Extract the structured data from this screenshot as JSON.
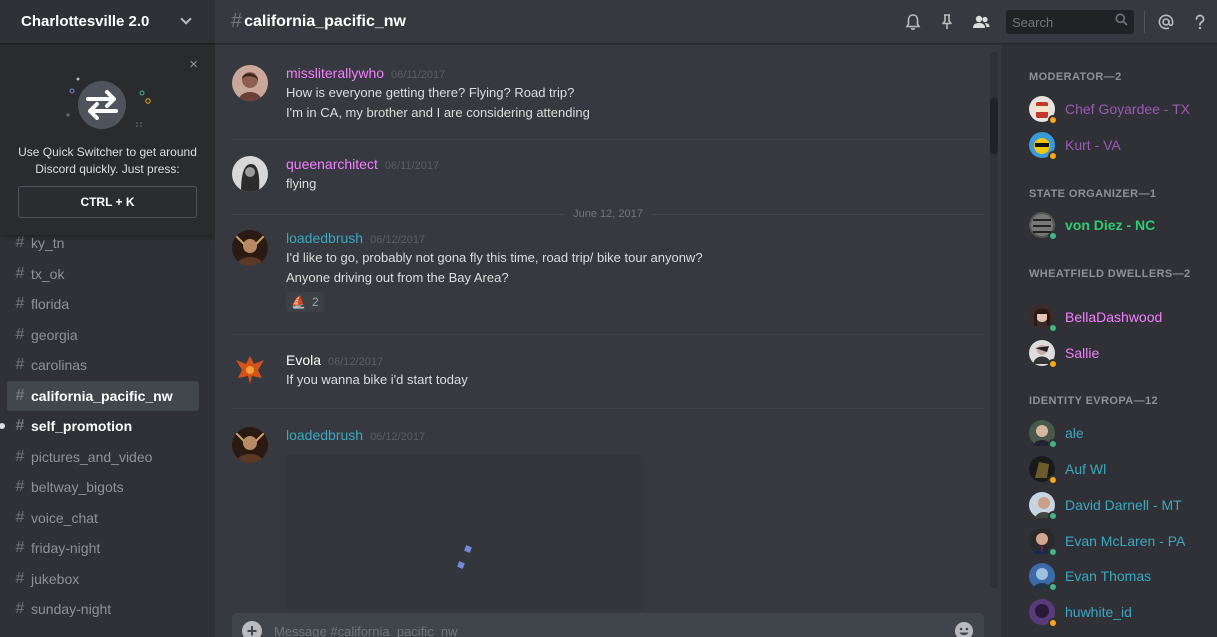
{
  "server": {
    "name": "Charlottesville 2.0"
  },
  "quick_switcher": {
    "text": "Use Quick Switcher to get around Discord quickly. Just press:",
    "shortcut": "CTRL + K",
    "close": "×"
  },
  "channels": [
    {
      "name": "ky_tn",
      "state": "normal"
    },
    {
      "name": "tx_ok",
      "state": "normal"
    },
    {
      "name": "florida",
      "state": "normal"
    },
    {
      "name": "georgia",
      "state": "normal"
    },
    {
      "name": "carolinas",
      "state": "normal"
    },
    {
      "name": "california_pacific_nw",
      "state": "active"
    },
    {
      "name": "self_promotion",
      "state": "unread"
    },
    {
      "name": "pictures_and_video",
      "state": "normal"
    },
    {
      "name": "beltway_bigots",
      "state": "normal"
    },
    {
      "name": "voice_chat",
      "state": "normal"
    },
    {
      "name": "friday-night",
      "state": "normal"
    },
    {
      "name": "jukebox",
      "state": "normal"
    },
    {
      "name": "sunday-night",
      "state": "normal"
    }
  ],
  "header": {
    "hash": "#",
    "channel": "california_pacific_nw",
    "search_placeholder": "Search"
  },
  "messages": [
    {
      "author": "missliterallywho",
      "color": "#f47fff",
      "timestamp": "06/11/2017",
      "lines": [
        "How is everyone getting there? Flying? Road trip?",
        "I'm in CA, my brother and I are considering attending"
      ]
    },
    {
      "author": "queenarchitect",
      "color": "#f47fff",
      "timestamp": "06/11/2017",
      "lines": [
        "flying"
      ]
    },
    {
      "date_divider": "June 12, 2017"
    },
    {
      "author": "loadedbrush",
      "color": "#3aa8c1",
      "timestamp": "06/12/2017",
      "lines": [
        "I'd like to go, probably not gona fly this time, road trip/ bike tour anyonw?",
        "Anyone driving out from the Bay Area?"
      ],
      "reaction": {
        "emoji": "⛵",
        "count": "2"
      }
    },
    {
      "author": "Evola",
      "color": "#ffffff",
      "timestamp": "06/12/2017",
      "lines": [
        "If you wanna bike i'd start today"
      ]
    },
    {
      "author": "loadedbrush",
      "color": "#3aa8c1",
      "timestamp": "06/12/2017",
      "lines": []
    }
  ],
  "composer": {
    "placeholder": "Message #california_pacific_nw",
    "upload": "+"
  },
  "members": {
    "groups": [
      {
        "title": "MODERATOR—2",
        "members": [
          {
            "name": "Chef Goyardee - TX",
            "color": "#9b59b6",
            "status": "#faa61a"
          },
          {
            "name": "Kurt - VA",
            "color": "#9b59b6",
            "status": "#faa61a"
          }
        ]
      },
      {
        "title": "STATE ORGANIZER—1",
        "members": [
          {
            "name": "von Diez - NC",
            "color": "#2ecc71",
            "status": "#43b581"
          }
        ]
      },
      {
        "title": "WHEATFIELD DWELLERS—2",
        "members": [
          {
            "name": "BellaDashwood",
            "color": "#f47fff",
            "status": "#43b581"
          },
          {
            "name": "Sallie",
            "color": "#f47fff",
            "status": "#faa61a"
          }
        ]
      },
      {
        "title": "IDENTITY EVROPA—12",
        "members": [
          {
            "name": "ale",
            "color": "#3aa8c1",
            "status": "#43b581"
          },
          {
            "name": "Auf Wl",
            "color": "#3aa8c1",
            "status": "#faa61a"
          },
          {
            "name": "David Darnell - MT",
            "color": "#3aa8c1",
            "status": "#43b581"
          },
          {
            "name": "Evan McLaren - PA",
            "color": "#3aa8c1",
            "status": "#43b581"
          },
          {
            "name": "Evan Thomas",
            "color": "#3aa8c1",
            "status": "#43b581"
          },
          {
            "name": "huwhite_id",
            "color": "#3aa8c1",
            "status": "#faa61a"
          }
        ]
      }
    ]
  }
}
